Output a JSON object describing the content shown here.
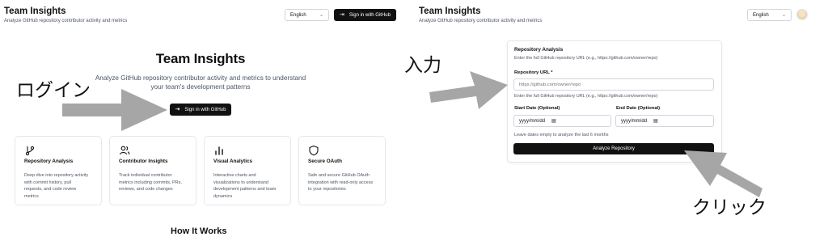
{
  "left_header": {
    "title": "Team Insights",
    "subtitle": "Analyze GitHub repository contributor activity and metrics",
    "language_select": "English",
    "signin_button": "Sign in with GitHub"
  },
  "hero": {
    "title": "Team Insights",
    "description_line1": "Analyze GitHub repository contributor activity and metrics to understand",
    "description_line2": "your team's development patterns",
    "signin_button": "Sign in with GitHub"
  },
  "features": [
    {
      "icon": "git-branch-icon",
      "title": "Repository Analysis",
      "lines": [
        "Deep dive into repository activity",
        "with commit history, pull",
        "requests, and code review",
        "metrics"
      ]
    },
    {
      "icon": "users-icon",
      "title": "Contributor Insights",
      "lines": [
        "Track individual contributor",
        "metrics including commits, PRs,",
        "reviews, and code changes"
      ]
    },
    {
      "icon": "bar-chart-icon",
      "title": "Visual Analytics",
      "lines": [
        "Interactive charts and",
        "visualizations to understand",
        "development patterns and team",
        "dynamics"
      ]
    },
    {
      "icon": "shield-icon",
      "title": "Secure OAuth",
      "lines": [
        "Safe and secure GitHub OAuth",
        "integration with read-only access",
        "to your repositories"
      ]
    }
  ],
  "how_it_works": "How It Works",
  "right_header": {
    "title": "Team Insights",
    "subtitle": "Analyze GitHub repository contributor activity and metrics",
    "language_select": "English"
  },
  "form": {
    "title": "Repository Analysis",
    "subtitle": "Enter the full GitHub repository URL (e.g., https://github.com/owner/repo)",
    "url_label": "Repository URL *",
    "url_placeholder": "https://github.com/owner/repo",
    "url_help": "Enter the full GitHub repository URL (e.g., https://github.com/owner/repo)",
    "start_label": "Start Date (Optional)",
    "end_label": "End Date (Optional)",
    "date_placeholder": "yyyy/mm/dd",
    "date_hint": "Leave dates empty to analyze the last 6 months",
    "submit_button": "Analyze Repository"
  },
  "annotations": {
    "login": "ログイン",
    "input": "入力",
    "click": "クリック"
  },
  "colors": {
    "dark_button": "#111111",
    "arrow": "#a6a6a6",
    "border": "#e5e7eb"
  }
}
